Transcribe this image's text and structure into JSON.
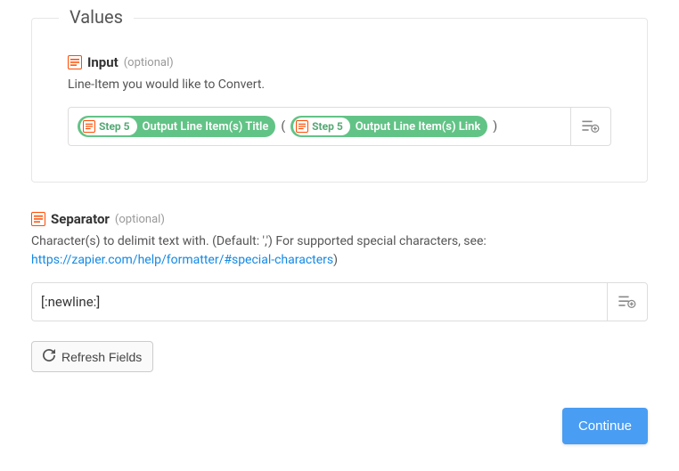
{
  "values": {
    "title": "Values",
    "input": {
      "label": "Input",
      "optional": "(optional)",
      "description": "Line-Item you would like to Convert.",
      "pills": [
        {
          "step": "Step 5",
          "label": "Output Line Item(s) Title"
        },
        {
          "step": "Step 5",
          "label": "Output Line Item(s) Link"
        }
      ],
      "open_paren": "(",
      "close_paren": ")"
    }
  },
  "separator": {
    "label": "Separator",
    "optional": "(optional)",
    "description_pre": "Character(s) to delimit text with. (Default: ',') For supported special characters, see: ",
    "description_link_text": "https://zapier.com/help/formatter/#special-characters",
    "description_link_href": "https://zapier.com/help/formatter/#special-characters",
    "description_post": ")",
    "value": "[:newline:]"
  },
  "refresh_label": "Refresh Fields",
  "continue_label": "Continue"
}
